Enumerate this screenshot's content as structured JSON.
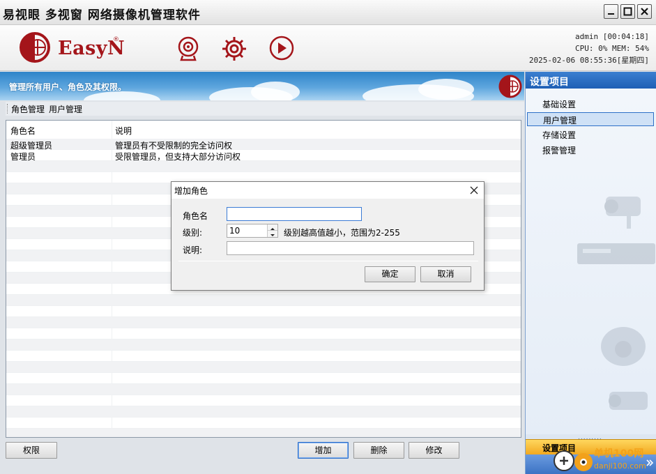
{
  "window": {
    "title": "易视眼 多视窗 网络摄像机管理软件"
  },
  "header": {
    "brand": "EasyN",
    "brand_reg": "®",
    "toolbar_icons": [
      "camera-icon",
      "gear-icon",
      "play-icon"
    ],
    "status": {
      "line1": "admin [00:04:18]",
      "line2": "CPU:  0% MEM: 54%",
      "line3": "2025-02-06 08:55:36[星期四]"
    }
  },
  "banner": {
    "text": "管理所有用户、角色及其权限。"
  },
  "tabs": [
    {
      "label": "角色管理",
      "active": true
    },
    {
      "label": "用户管理",
      "active": false
    }
  ],
  "role_table": {
    "columns": [
      "角色名",
      "说明"
    ],
    "rows": [
      {
        "name": "超级管理员",
        "desc": "管理员有不受限制的完全访问权"
      },
      {
        "name": "管理员",
        "desc": "受限管理员，但支持大部分访问权"
      }
    ]
  },
  "buttons": {
    "permission": "权限",
    "add": "增加",
    "delete": "删除",
    "modify": "修改"
  },
  "settings_panel": {
    "title": "设置项目",
    "items": [
      {
        "label": "基础设置",
        "selected": false
      },
      {
        "label": "用户管理",
        "selected": true
      },
      {
        "label": "存储设置",
        "selected": false
      },
      {
        "label": "报警管理",
        "selected": false
      }
    ],
    "footer": "设置项目"
  },
  "dialog": {
    "title": "增加角色",
    "fields": {
      "role_name_label": "角色名",
      "role_name_value": "",
      "level_label": "级别:",
      "level_value": "10",
      "level_hint": "级别越高值越小，范围为2-255",
      "desc_label": "说明:",
      "desc_value": ""
    },
    "ok": "确定",
    "cancel": "取消"
  },
  "watermark": {
    "line1": "单机100网",
    "line2": "danji100.com"
  },
  "colors": {
    "brand_red": "#a4151a",
    "panel_blue": "#1f5fb5",
    "accent_orange": "#f1a81f"
  }
}
